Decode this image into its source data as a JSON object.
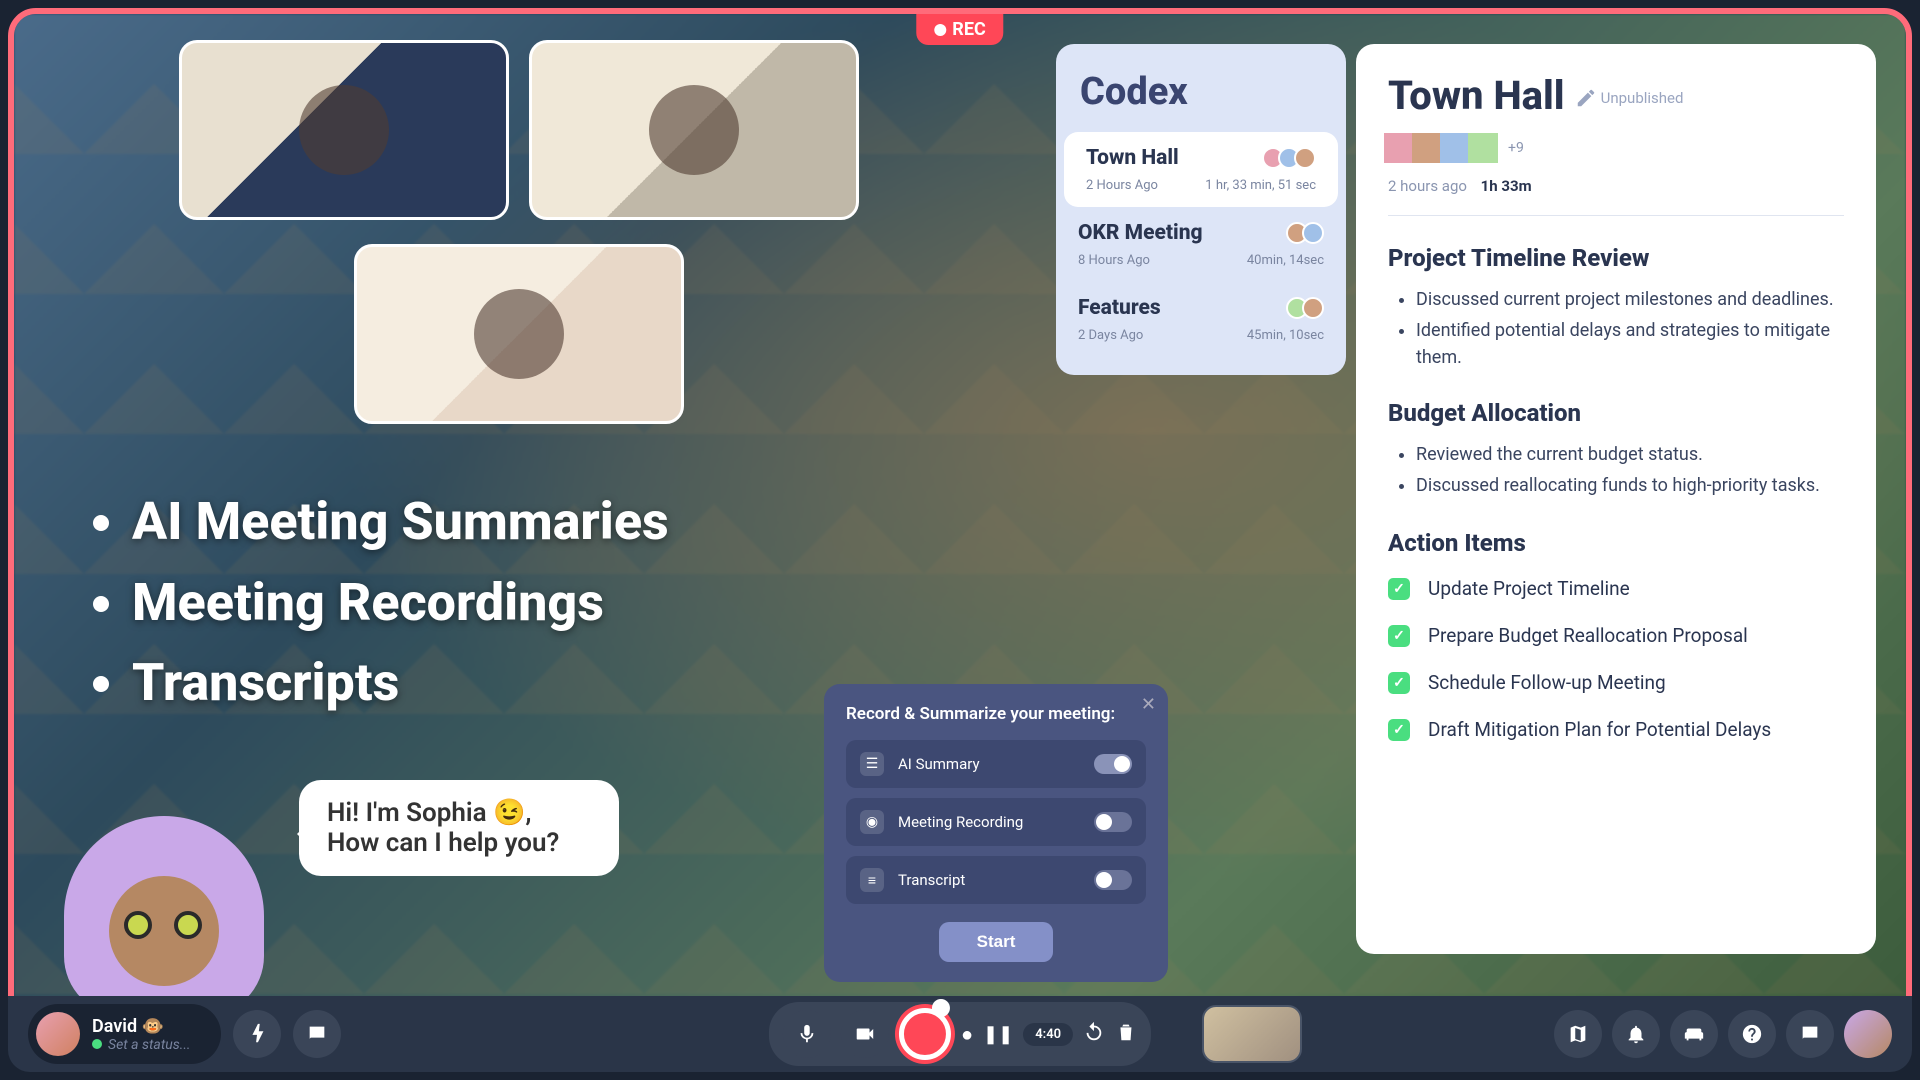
{
  "rec_label": "REC",
  "features": [
    "AI Meeting Summaries",
    "Meeting Recordings",
    "Transcripts"
  ],
  "sophia_bubble": "Hi! I'm Sophia 😉,\nHow can I help you?",
  "record_dialog": {
    "title": "Record & Summarize your meeting:",
    "rows": [
      {
        "label": "AI Summary",
        "on": true
      },
      {
        "label": "Meeting Recording",
        "on": false
      },
      {
        "label": "Transcript",
        "on": false
      }
    ],
    "start": "Start"
  },
  "codex": {
    "title": "Codex",
    "items": [
      {
        "title": "Town Hall",
        "sub": "2 Hours Ago",
        "dur": "1 hr, 33 min, 51 sec",
        "active": true
      },
      {
        "title": "OKR Meeting",
        "sub": "8 Hours Ago",
        "dur": "40min, 14sec",
        "active": false
      },
      {
        "title": "Features",
        "sub": "2 Days Ago",
        "dur": "45min, 10sec",
        "active": false
      }
    ]
  },
  "detail": {
    "title": "Town Hall",
    "unpublished": "Unpublished",
    "more_count": "+9",
    "ago": "2 hours ago",
    "duration": "1h 33m",
    "sections": [
      {
        "heading": "Project Timeline Review",
        "bullets": [
          "Discussed current project milestones and deadlines.",
          "Identified potential delays and strategies to mitigate them."
        ]
      },
      {
        "heading": "Budget Allocation",
        "bullets": [
          "Reviewed the current budget status.",
          "Discussed reallocating funds to high-priority tasks."
        ]
      }
    ],
    "action_heading": "Action Items",
    "actions": [
      "Update Project Timeline",
      "Prepare Budget Reallocation Proposal",
      "Schedule Follow-up Meeting",
      "Draft Mitigation Plan for Potential Delays"
    ]
  },
  "bottom": {
    "user_name": "David 🐵",
    "status_placeholder": "Set a status...",
    "timer": "4:40"
  }
}
